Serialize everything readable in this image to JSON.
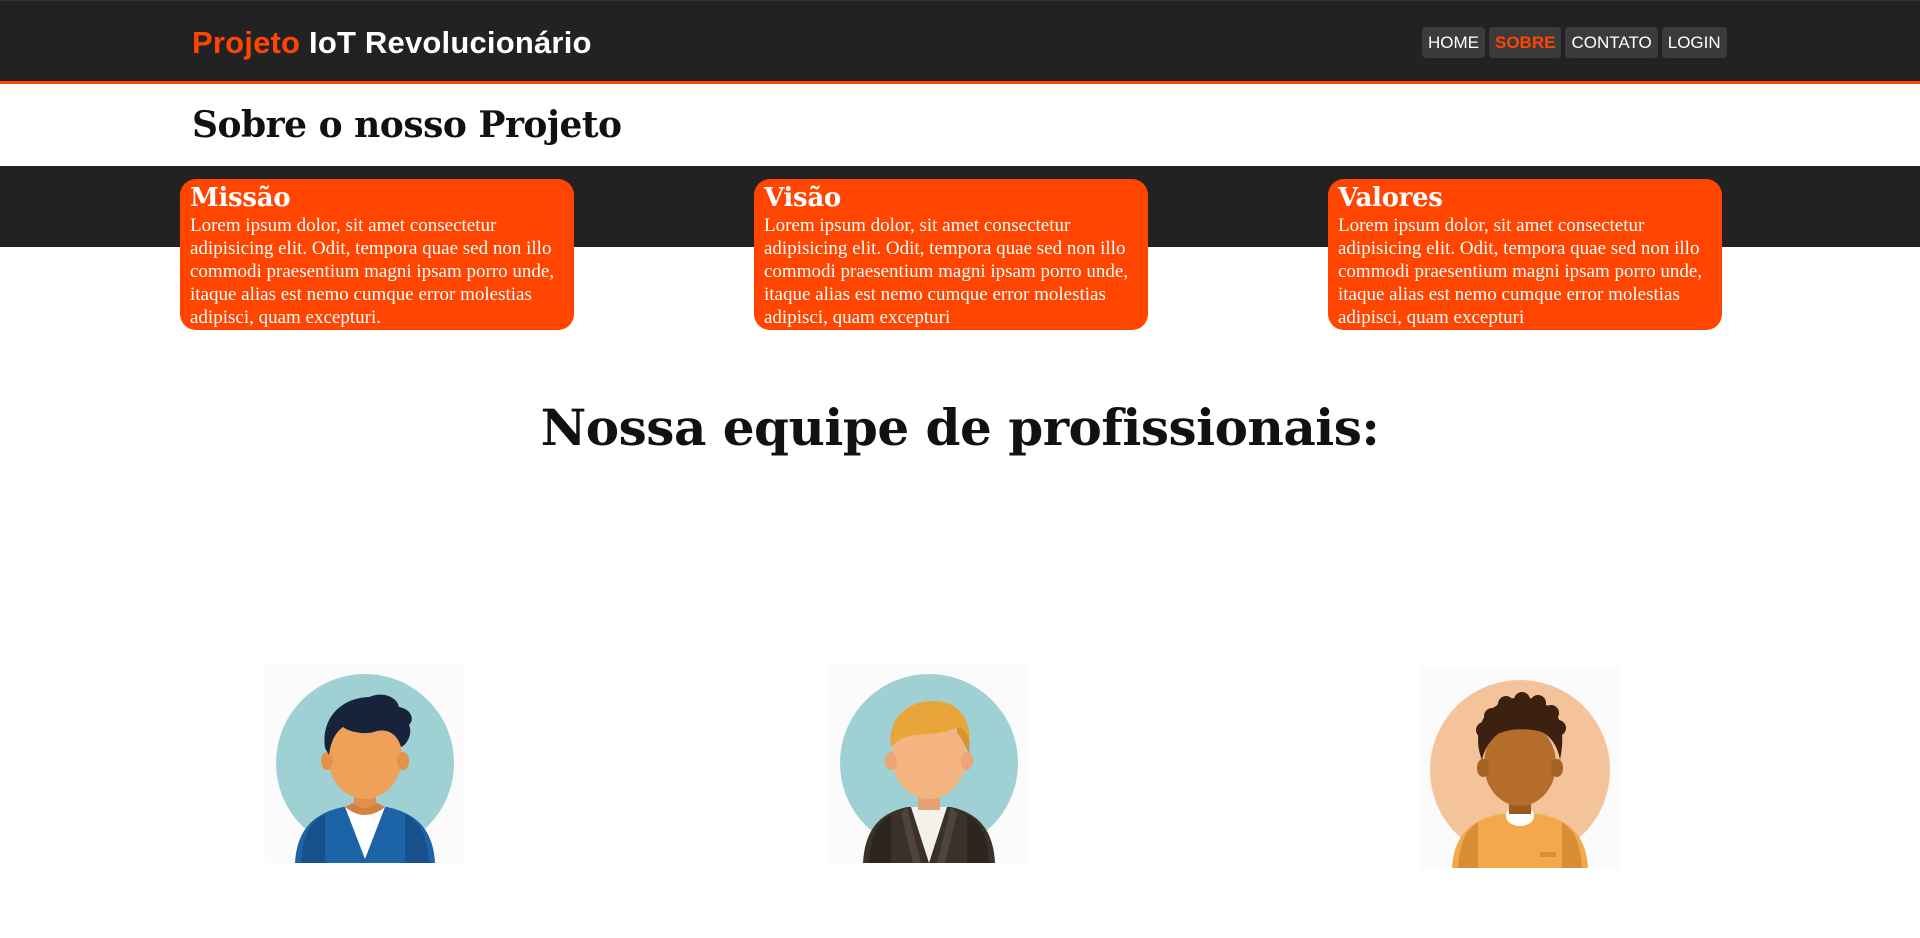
{
  "header": {
    "brand_accent": "Projeto",
    "brand_rest": " IoT Revolucionário",
    "nav": [
      "HOME",
      "SOBRE",
      "CONTATO",
      "LOGIN"
    ],
    "active_nav": "SOBRE"
  },
  "page_title": "Sobre o nosso Projeto",
  "cards": [
    {
      "title": "Missão",
      "text": "Lorem ipsum dolor, sit amet consectetur adipisicing elit. Odit, tempora quae sed non illo commodi praesentium magni ipsam porro unde, itaque alias est nemo cumque error molestias adipisci, quam excepturi."
    },
    {
      "title": "Visão",
      "text": "Lorem ipsum dolor, sit amet consectetur adipisicing elit. Odit, tempora quae sed non illo commodi praesentium magni ipsam porro unde, itaque alias est nemo cumque error molestias adipisci, quam excepturi"
    },
    {
      "title": "Valores",
      "text": "Lorem ipsum dolor, sit amet consectetur adipisicing elit. Odit, tempora quae sed non illo commodi praesentium magni ipsam porro unde, itaque alias est nemo cumque error molestias adipisci, quam excepturi"
    }
  ],
  "team": {
    "heading": "Nossa equipe de profissionais:",
    "members": [
      {
        "avatar": "male-avatar-black-hair"
      },
      {
        "avatar": "male-avatar-blond-hair"
      },
      {
        "avatar": "male-avatar-curly-hair"
      }
    ]
  },
  "colors": {
    "accent": "#ff4500",
    "dark": "#222222",
    "nav_button": "#3b3b3b"
  }
}
